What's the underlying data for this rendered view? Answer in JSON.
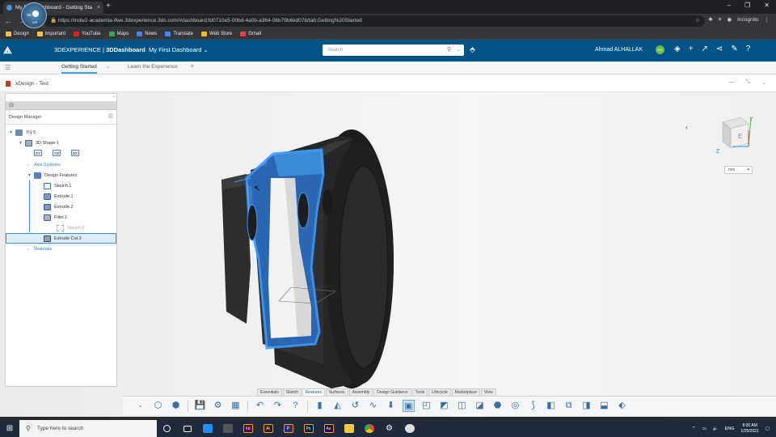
{
  "browser": {
    "tab_title": "My First Dashboard - Getting Sta",
    "tab_close": "×",
    "new_tab": "+",
    "url": "https://indw2-academia-ifwe.3dexperience.3ds.com/#dashboard:fd0710e5-00bd-4a0b-a364-06b79b6ed07b/tab:Getting%20Started",
    "profile_label": "Incognito",
    "bookmarks": [
      {
        "label": "Design",
        "color": "#f6c343"
      },
      {
        "label": "Important",
        "color": "#f6c343"
      },
      {
        "label": "YouTube",
        "color": "#e62117"
      },
      {
        "label": "Maps",
        "color": "#34a853"
      },
      {
        "label": "News",
        "color": "#4285f4"
      },
      {
        "label": "Translate",
        "color": "#4285f4"
      },
      {
        "label": "Web Store",
        "color": "#fbbc05"
      },
      {
        "label": "Gmail",
        "color": "#ea4335"
      }
    ]
  },
  "app": {
    "brand_prefix": "3DEXPERIENCE | ",
    "brand_app": "3DDashboard",
    "dashboard_name": "My First Dashboard",
    "search_placeholder": "Search",
    "user_name": "Ahmad ALHALLAK",
    "user_initials": "AA",
    "compass_label": "3D",
    "compass_vr": "V,R"
  },
  "dashboard_tabs": [
    {
      "label": "Getting Started",
      "active": true
    },
    {
      "label": "Learn the Experience",
      "active": false
    }
  ],
  "app_title": "xDesign - Test",
  "design_manager": {
    "title": "Design Manager",
    "axis_labels": [
      "XY",
      "YZ",
      "ZX"
    ],
    "tree": {
      "root": "Try 5",
      "shape": "3D Shape 1",
      "axis_systems": "Axis Systems",
      "design_features": "Design Features",
      "features": [
        "Sketch.1",
        "Extrude.1",
        "Extrude.2",
        "Fillet.1",
        "Sketch.2",
        "Extrude Cut.3"
      ],
      "materials": "Materials"
    }
  },
  "units": {
    "selected": "mm"
  },
  "action_bar": {
    "tabs": [
      "Essentials",
      "Sketch",
      "Features",
      "Surfaces",
      "Assembly",
      "Design Guidance",
      "Tools",
      "Lifecycle",
      "Marketplace",
      "View"
    ],
    "active_tab": "Features"
  },
  "taskbar": {
    "search_placeholder": "Type here to search",
    "apps": [
      {
        "name": "xd",
        "label": "Xd",
        "color": "#470137"
      },
      {
        "name": "ai",
        "label": "Ai",
        "color": "#331c00"
      },
      {
        "name": "ps-like",
        "label": "P",
        "color": "#2b2b6b"
      },
      {
        "name": "ps",
        "label": "Ps",
        "color": "#001d34"
      },
      {
        "name": "ae",
        "label": "Ae",
        "color": "#1f0040"
      }
    ],
    "lang": "ENG",
    "time": "8:00 AM",
    "date": "1/25/2021"
  },
  "colors": {
    "brand": "#005386",
    "accent": "#42a2da",
    "selection": "#3a8ee6"
  }
}
